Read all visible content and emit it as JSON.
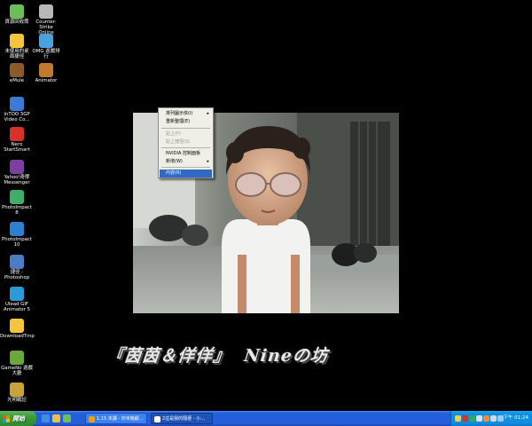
{
  "desktop": {
    "icons": [
      {
        "label": "資源回收筒",
        "icon": "recycle-bin-icon",
        "color": "#6bbf59"
      },
      {
        "label": "Counter-Strike\nOnline",
        "icon": "counter-strike-icon",
        "color": "#b8b8b8"
      },
      {
        "label": "未使用的桌\n面捷徑",
        "icon": "folder-icon",
        "color": "#f2c53d"
      },
      {
        "label": "OMG 遊戲排\n行",
        "icon": "omg-game-icon",
        "color": "#4aa3df"
      },
      {
        "label": "eMule",
        "icon": "emule-icon",
        "color": "#8a5a2b"
      },
      {
        "label": "Animator",
        "icon": "animator-icon",
        "color": "#c0792f"
      },
      {
        "label": "InTOO 3GP\nVideo Co...",
        "icon": "intoo-video-icon",
        "color": "#3a7bd5"
      },
      {
        "label": "Nero\nStartSmart",
        "icon": "nero-icon",
        "color": "#d9302c"
      },
      {
        "label": "Yahoo!奇摩\nMessenger",
        "icon": "yahoo-messenger-icon",
        "color": "#7b3fa0"
      },
      {
        "label": "PhotoImpact 8",
        "icon": "photoimpact-8-icon",
        "color": "#3fae6a"
      },
      {
        "label": "PhotoImpact\n10",
        "icon": "photoimpact-10-icon",
        "color": "#2f7fd0"
      },
      {
        "label": "捷徑 -\nPhotoshop",
        "icon": "photoshop-icon",
        "color": "#4d7cc4"
      },
      {
        "label": "Ulead GIF\nAnimator 5",
        "icon": "ulead-gif-icon",
        "color": "#2c9ad8"
      },
      {
        "label": "DownloadTmp",
        "icon": "folder-icon",
        "color": "#f2c53d"
      },
      {
        "label": "GameNo 遊戲\n大廳",
        "icon": "gameno-icon",
        "color": "#6aa83a"
      },
      {
        "label": "光明戰記",
        "icon": "game-icon",
        "color": "#c9a23a"
      }
    ]
  },
  "context_menu": {
    "items": [
      {
        "label": "排列圖示依(I)",
        "submenu": true,
        "enabled": true
      },
      {
        "label": "重新整理(E)",
        "submenu": false,
        "enabled": true
      },
      {
        "label": "貼上(P)",
        "submenu": false,
        "enabled": false
      },
      {
        "label": "貼上捷徑(S)",
        "submenu": false,
        "enabled": false
      },
      {
        "label": "NVIDIA 控制面板",
        "submenu": false,
        "enabled": true
      },
      {
        "label": "新增(W)",
        "submenu": true,
        "enabled": true
      },
      {
        "label": "內容(R)",
        "submenu": false,
        "enabled": true,
        "selected": true
      }
    ],
    "submenu_arrow": "▸"
  },
  "overlay_text": "『茵茵＆佯佯』  Nineの坊",
  "taskbar": {
    "start_label": "開始",
    "quick_launch": [
      {
        "icon": "ie-icon",
        "color": "#3d8fe0"
      },
      {
        "icon": "outlook-icon",
        "color": "#e8c341"
      },
      {
        "icon": "show-desktop-icon",
        "color": "#6bbf59"
      }
    ],
    "tasks": [
      {
        "label": "1.15 未讀 - 你未機顧...",
        "icon": "messenger-icon",
        "color": "#e0a020"
      },
      {
        "label": "2這是我的隨便 - 小...",
        "icon": "ie-window-icon",
        "color": "#ffffff"
      }
    ],
    "tray_icons": [
      {
        "icon": "tray-icon-1",
        "color": "#ffcc33"
      },
      {
        "icon": "tray-icon-2",
        "color": "#d9302c"
      },
      {
        "icon": "tray-icon-3",
        "color": "#33aa55"
      },
      {
        "icon": "tray-icon-4",
        "color": "#e0e0e0"
      },
      {
        "icon": "tray-icon-5",
        "color": "#ff8833"
      },
      {
        "icon": "volume-icon",
        "color": "#cfd8e8"
      },
      {
        "icon": "network-icon",
        "color": "#a0c8f0"
      }
    ],
    "clock": "下午 01:24"
  },
  "colors": {
    "desktop_bg": "#000000",
    "taskbar": "#245edb",
    "start": "#3c9a3a",
    "menu_highlight": "#316ac5"
  }
}
